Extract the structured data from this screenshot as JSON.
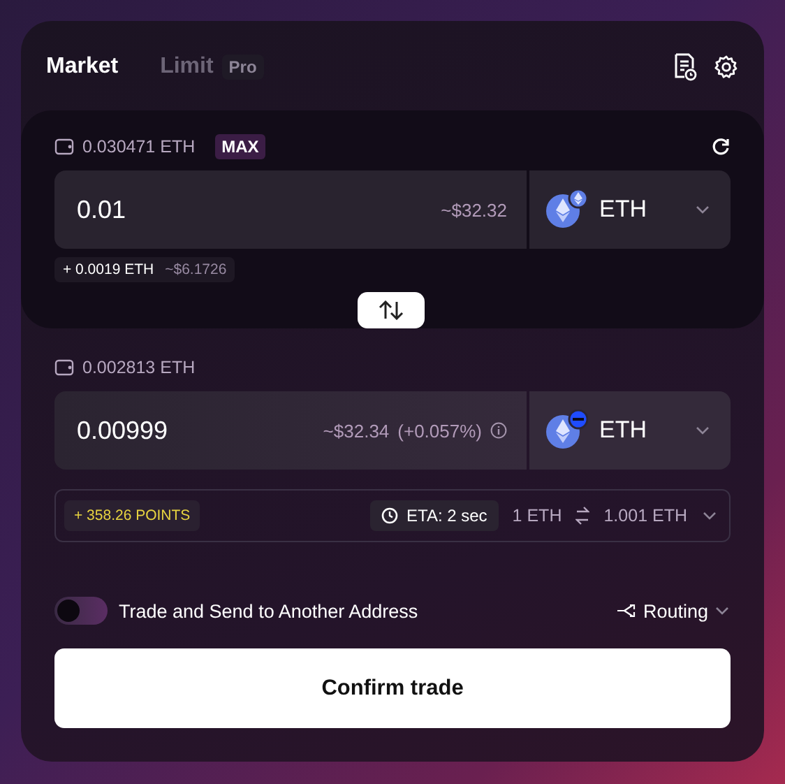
{
  "tabs": [
    {
      "label": "Market",
      "selected": true
    },
    {
      "label": "Limit",
      "selected": false,
      "badge": "Pro"
    }
  ],
  "pay": {
    "balance": "0.030471 ETH",
    "max": "MAX",
    "amount": "0.01",
    "usd": "~$32.32",
    "token": "ETH",
    "bonus": "+ 0.0019 ETH",
    "bonus_usd": "~$6.1726"
  },
  "receive": {
    "balance": "0.002813 ETH",
    "amount": "0.00999",
    "usd": "~$32.34",
    "diff": "(+0.057%)",
    "token": "ETH"
  },
  "details": {
    "points": "+ 358.26 POINTS",
    "eta": "ETA: 2 sec",
    "rate_from": "1 ETH",
    "rate_to": "1.001 ETH"
  },
  "send_toggle": {
    "label": "Trade and Send to Another Address",
    "on": false
  },
  "routing": "Routing",
  "confirm": "Confirm trade"
}
